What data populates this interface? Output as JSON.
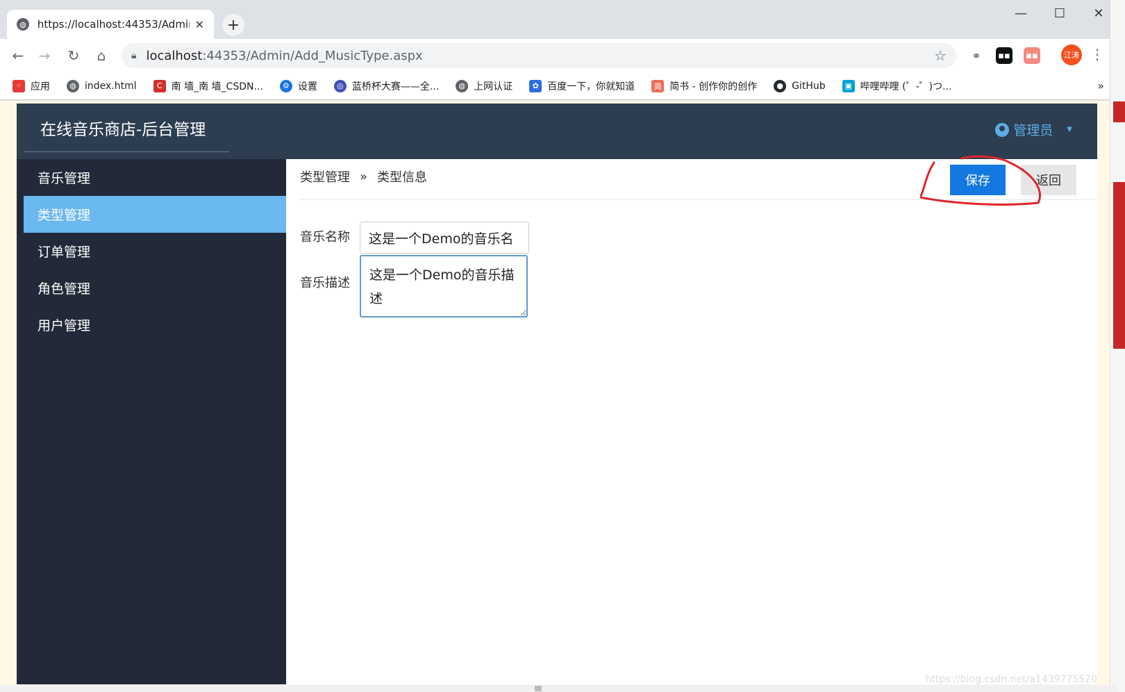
{
  "browser": {
    "tab_title": "https://localhost:44353/Admin/Add_MusicType.aspx",
    "tab_close": "✕",
    "new_tab": "+",
    "window_controls": {
      "minimize": "—",
      "maximize": "☐",
      "close": "✕"
    },
    "url_host": "localhost",
    "url_path": ":44353/Admin/Add_MusicType.aspx",
    "profile_label": "江涛",
    "bookmarks": [
      {
        "label": "应用",
        "icon": "apps-grid-icon",
        "color": "#e53935"
      },
      {
        "label": "index.html",
        "icon": "globe-icon",
        "color": "#5f6368"
      },
      {
        "label": "南 墙_南 墙_CSDN...",
        "icon": "csdn-icon",
        "color": "#d32f2f"
      },
      {
        "label": "设置",
        "icon": "gear-icon",
        "color": "#1a73e8"
      },
      {
        "label": "蓝桥杯大赛——全...",
        "icon": "lanqiao-icon",
        "color": "#3f51b5"
      },
      {
        "label": "上网认证",
        "icon": "globe-icon",
        "color": "#5f6368"
      },
      {
        "label": "百度一下，你就知道",
        "icon": "baidu-paw-icon",
        "color": "#2b6de0"
      },
      {
        "label": "简书 - 创作你的创作",
        "icon": "jianshu-icon",
        "color": "#ea6f5a"
      },
      {
        "label": "GitHub",
        "icon": "github-icon",
        "color": "#24292e"
      },
      {
        "label": "哔哩哔哩 (゜-゜)つ...",
        "icon": "bilibili-icon",
        "color": "#00a1d6"
      }
    ],
    "bookmarks_more": "»"
  },
  "app": {
    "brand": "在线音乐商店-后台管理",
    "user_label": "管理员",
    "sidebar": [
      {
        "label": "音乐管理",
        "active": false
      },
      {
        "label": "类型管理",
        "active": true
      },
      {
        "label": "订单管理",
        "active": false
      },
      {
        "label": "角色管理",
        "active": false
      },
      {
        "label": "用户管理",
        "active": false
      }
    ],
    "breadcrumb": {
      "parent": "类型管理",
      "separator": "»",
      "current": "类型信息"
    },
    "buttons": {
      "save": "保存",
      "back": "返回"
    },
    "form": {
      "name_label": "音乐名称",
      "name_value": "这是一个Demo的音乐名",
      "desc_label": "音乐描述",
      "desc_value": "这是一个Demo的音乐描述"
    }
  },
  "watermark": "https://blog.csdn.net/a1439775520",
  "colors": {
    "appbar": "#2c3e50",
    "sidebar": "#222a3a",
    "sidebar_active": "#6ab8f0",
    "save_button": "#1379e0",
    "annotation": "#e0242b"
  }
}
